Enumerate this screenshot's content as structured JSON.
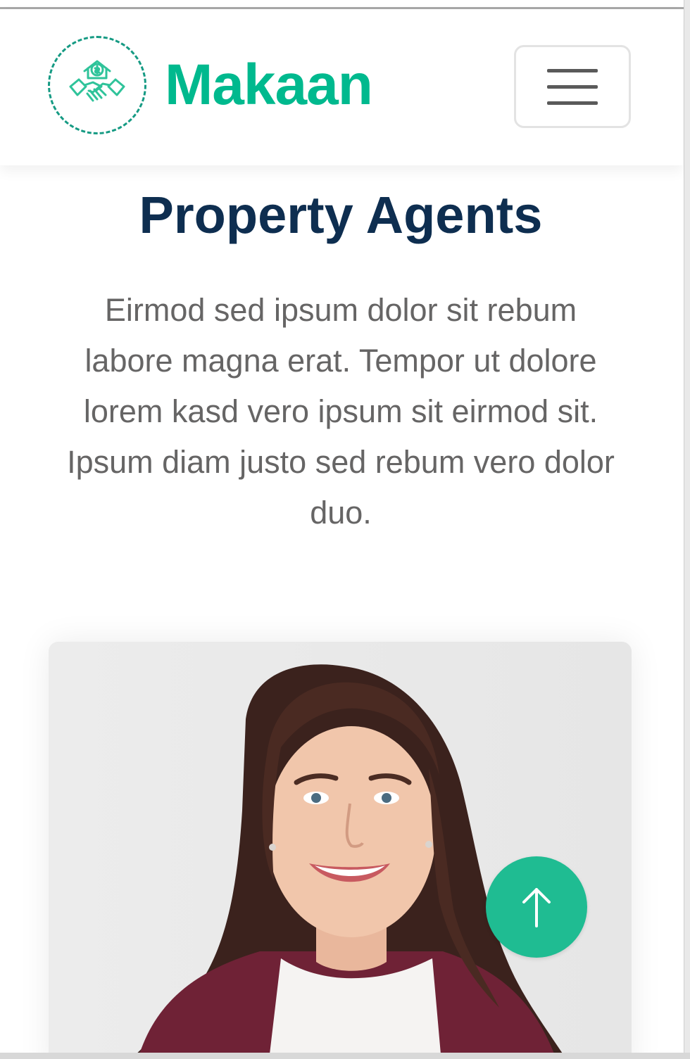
{
  "navbar": {
    "brand_name": "Makaan",
    "logo_icon": "handshake-house-icon",
    "menu_icon": "hamburger-icon"
  },
  "section": {
    "title": "Property Agents",
    "description": "Eirmod sed ipsum dolor sit rebum labore magna erat. Tempor ut dolore lorem kasd vero ipsum sit eirmod sit. Ipsum diam justo sed rebum vero dolor duo."
  },
  "agent_card": {
    "photo": "agent-photo"
  },
  "back_to_top": {
    "icon": "arrow-up-icon"
  },
  "colors": {
    "primary": "#00b98e",
    "heading": "#0e2e50",
    "body_text": "#666565"
  }
}
